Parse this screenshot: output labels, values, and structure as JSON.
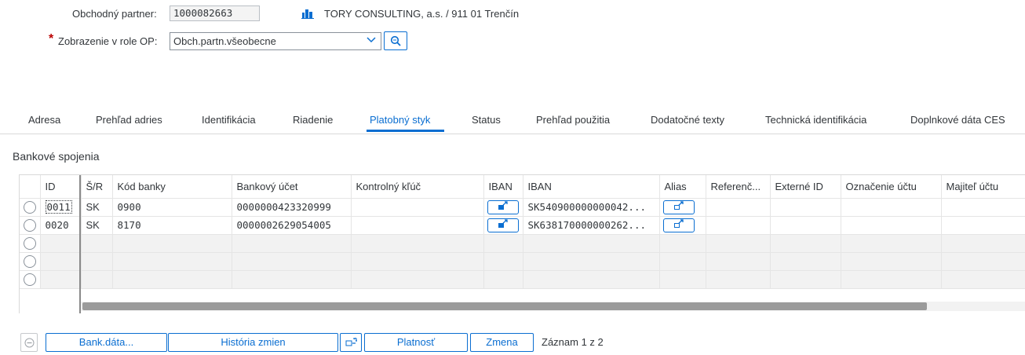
{
  "header": {
    "partner_label": "Obchodný partner:",
    "partner_value": "1000082663",
    "partner_desc": "TORY CONSULTING, a.s. / 911 01 Trenčín",
    "role_required": "*",
    "role_label": "Zobrazenie v role OP:",
    "role_value": "Obch.partn.všeobecne"
  },
  "tabs": [
    {
      "label": "Adresa"
    },
    {
      "label": "Prehľad adries"
    },
    {
      "label": "Identifikácia"
    },
    {
      "label": "Riadenie"
    },
    {
      "label": "Platobný styk"
    },
    {
      "label": "Status"
    },
    {
      "label": "Prehľad použitia"
    },
    {
      "label": "Dodatočné texty"
    },
    {
      "label": "Technická identifikácia"
    },
    {
      "label": "Doplnkové dáta CES"
    }
  ],
  "active_tab": "Platobný styk",
  "section_title": "Bankové spojenia",
  "table": {
    "columns": [
      "ID",
      "Š/R",
      "Kód banky",
      "Bankový účet",
      "Kontrolný kľúč",
      "IBAN",
      "IBAN",
      "Alias",
      "Referenč...",
      "Externé ID",
      "Označenie účtu",
      "Majiteľ účtu"
    ],
    "rows": [
      {
        "id": "0011",
        "country": "SK",
        "bank_code": "0900",
        "account": "0000000423320999",
        "check_key": "",
        "iban": "SK540900000000042...",
        "ref": "",
        "ext_id": "",
        "acct_name": "",
        "holder": ""
      },
      {
        "id": "0020",
        "country": "SK",
        "bank_code": "8170",
        "account": "0000002629054005",
        "check_key": "",
        "iban": "SK638170000000262...",
        "ref": "",
        "ext_id": "",
        "acct_name": "",
        "holder": ""
      }
    ],
    "empty_rows": 3
  },
  "footer": {
    "bank_data_label": "Bank.dáta...",
    "history_label": "História zmien",
    "validity_label": "Platnosť",
    "change_label": "Zmena",
    "record_text": "Záznam 1 z 2"
  },
  "colors": {
    "accent": "#0a6ed1",
    "required": "#bb0000",
    "empty_row_bg": "#f2f2f2",
    "scrollbar": "#9b9b9b"
  }
}
